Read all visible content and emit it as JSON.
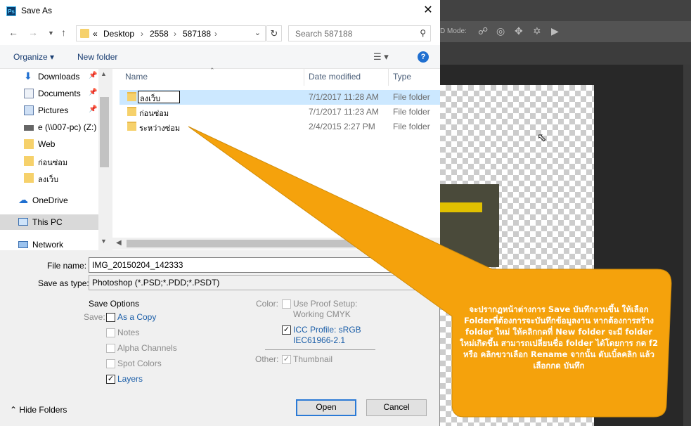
{
  "photoshop": {
    "mode_label": "D Mode:"
  },
  "dialog": {
    "title": "Save As",
    "address": {
      "prefix": "«",
      "crumbs": [
        "Desktop",
        "2558",
        "587188"
      ]
    },
    "search_placeholder": "Search 587188",
    "toolbar": {
      "organize": "Organize ▾",
      "new_folder": "New folder"
    },
    "nav_pane": [
      {
        "label": "Downloads",
        "icon": "download-icon",
        "pinned": true
      },
      {
        "label": "Documents",
        "icon": "documents-icon",
        "pinned": true
      },
      {
        "label": "Pictures",
        "icon": "pictures-icon",
        "pinned": true
      },
      {
        "label": "e (\\\\007-pc) (Z:)",
        "icon": "network-drive-icon",
        "pinned": false
      },
      {
        "label": "Web",
        "icon": "folder-icon",
        "pinned": false
      },
      {
        "label": "ก่อนซ่อม",
        "icon": "folder-icon",
        "pinned": false
      },
      {
        "label": "ลงเว็บ",
        "icon": "folder-icon",
        "pinned": false
      },
      {
        "label": "OneDrive",
        "icon": "onedrive-icon",
        "pinned": false
      },
      {
        "label": "This PC",
        "icon": "this-pc-icon",
        "pinned": false
      },
      {
        "label": "Network",
        "icon": "network-icon",
        "pinned": false
      }
    ],
    "columns": [
      "Name",
      "Date modified",
      "Type"
    ],
    "files": [
      {
        "name": "ลงเว็บ",
        "date": "7/1/2017 11:28 AM",
        "type": "File folder"
      },
      {
        "name": "ก่อนซ่อม",
        "date": "7/1/2017 11:23 AM",
        "type": "File folder"
      },
      {
        "name": "ระหว่างซ่อม",
        "date": "2/4/2015 2:27 PM",
        "type": "File folder"
      }
    ],
    "file_name_label": "File name:",
    "file_name_value": "IMG_20150204_142333",
    "save_type_label": "Save as type:",
    "save_type_value": "Photoshop (*.PSD;*.PDD;*.PSDT)",
    "save_options": {
      "heading": "Save Options",
      "save_label": "Save:",
      "as_a_copy": "As a Copy",
      "notes": "Notes",
      "alpha_channels": "Alpha Channels",
      "spot_colors": "Spot Colors",
      "layers": "Layers",
      "color_label": "Color:",
      "use_proof_line1": "Use Proof Setup:",
      "use_proof_line2": "Working CMYK",
      "icc_line1": "ICC Profile:  sRGB",
      "icc_line2": "IEC61966-2.1",
      "other_label": "Other:",
      "thumbnail": "Thumbnail"
    },
    "hide_folders": "Hide Folders",
    "open_button": "Open",
    "cancel_button": "Cancel"
  },
  "callout": {
    "text": "จะปรากฏหน้าต่างการ Save บันทึกงานขึ้น ให้เลือก Folderที่ต้องการจะบันทึกข้อมูลงาน หากต้องการสร้าง folder ใหม่ ให้คลิกกดที่ New folder จะมี folder ใหม่เกิดขึ้น สามารถเปลี่ยนชื่อ folder ได้โดยการ กด f2 หรือ คลิกขวาเลือก Rename จากนั้น ดับเบิ้ลคลิก แล้ว เลือกกด บันทึก",
    "color": "#f5a20c"
  }
}
